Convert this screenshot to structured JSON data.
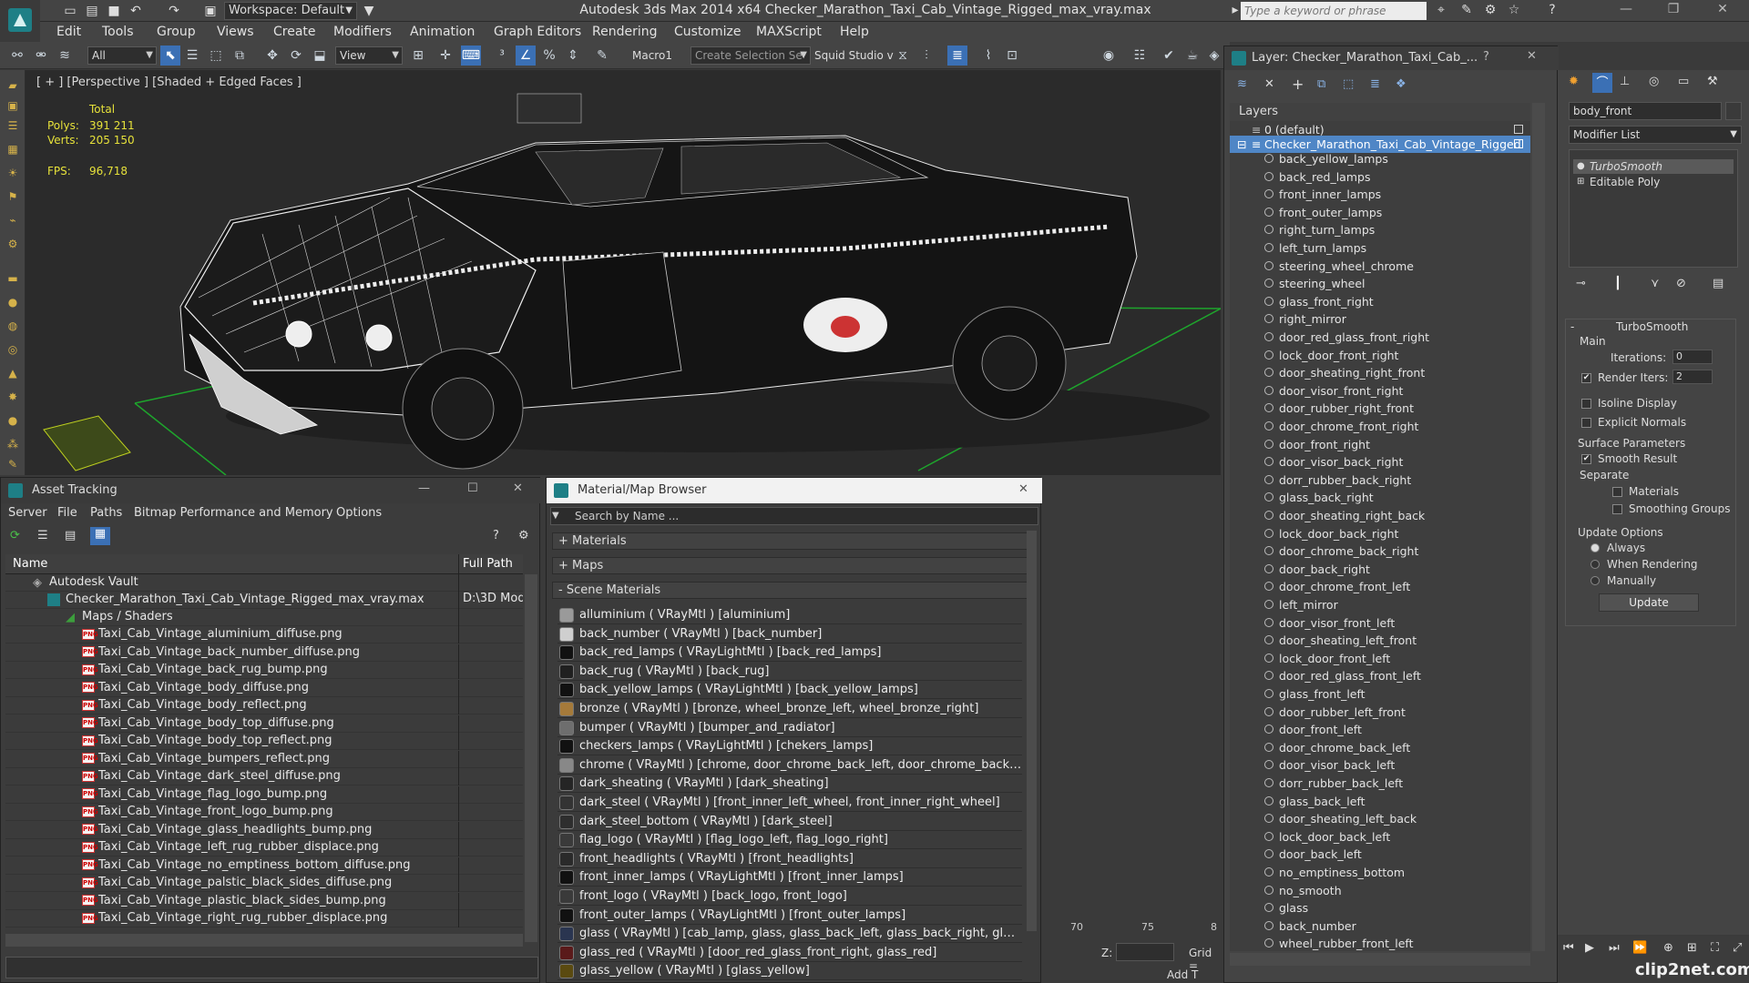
{
  "title_bar": {
    "workspace": "Workspace: Default",
    "title": "Autodesk 3ds Max  2014 x64    Checker_Marathon_Taxi_Cab_Vintage_Rigged_max_vray.max",
    "search_placeholder": "Type a keyword or phrase"
  },
  "menu": [
    "Edit",
    "Tools",
    "Group",
    "Views",
    "Create",
    "Modifiers",
    "Animation",
    "Graph Editors",
    "Rendering",
    "Customize",
    "MAXScript",
    "Help"
  ],
  "toolbar": {
    "selection_filter": "All",
    "ref_coord": "View",
    "macro": "Macro1",
    "selection_set": "Create Selection Se",
    "squid": "Squid Studio v"
  },
  "viewport": {
    "label": "[ + ] [Perspective ] [Shaded + Edged Faces ]",
    "stats": {
      "total_label": "Total",
      "polys_label": "Polys:",
      "polys_value": "391 211",
      "verts_label": "Verts:",
      "verts_value": "205 150",
      "fps_label": "FPS:",
      "fps_value": "96,718"
    }
  },
  "asset_tracking": {
    "title": "Asset Tracking",
    "menu": [
      "Server",
      "File",
      "Paths",
      "Bitmap Performance and Memory",
      "Options"
    ],
    "col_name": "Name",
    "col_path": "Full Path",
    "vault": "Autodesk Vault",
    "scene_file": "Checker_Marathon_Taxi_Cab_Vintage_Rigged_max_vray.max",
    "scene_path": "D:\\3D Mod",
    "maps_folder": "Maps / Shaders",
    "files": [
      "Taxi_Cab_Vintage_aluminium_diffuse.png",
      "Taxi_Cab_Vintage_back_number_diffuse.png",
      "Taxi_Cab_Vintage_back_rug_bump.png",
      "Taxi_Cab_Vintage_body_diffuse.png",
      "Taxi_Cab_Vintage_body_reflect.png",
      "Taxi_Cab_Vintage_body_top_diffuse.png",
      "Taxi_Cab_Vintage_body_top_reflect.png",
      "Taxi_Cab_Vintage_bumpers_reflect.png",
      "Taxi_Cab_Vintage_dark_steel_diffuse.png",
      "Taxi_Cab_Vintage_flag_logo_bump.png",
      "Taxi_Cab_Vintage_front_logo_bump.png",
      "Taxi_Cab_Vintage_glass_headlights_bump.png",
      "Taxi_Cab_Vintage_left_rug_rubber_displace.png",
      "Taxi_Cab_Vintage_no_emptiness_bottom_diffuse.png",
      "Taxi_Cab_Vintage_palstic_black_sides_diffuse.png",
      "Taxi_Cab_Vintage_plastic_black_sides_bump.png",
      "Taxi_Cab_Vintage_right_rug_rubber_displace.png"
    ]
  },
  "material_browser": {
    "title": "Material/Map Browser",
    "search_placeholder": "Search by Name ...",
    "rollout_materials": "+ Materials",
    "rollout_maps": "+ Maps",
    "rollout_scene": "- Scene Materials",
    "materials": [
      {
        "text": "alluminium  ( VRayMtl )  [aluminium]",
        "color": "#9a9a9a"
      },
      {
        "text": "back_number  ( VRayMtl )  [back_number]",
        "color": "#cfcfcf"
      },
      {
        "text": "back_red_lamps  ( VRayLightMtl )  [back_red_lamps]",
        "color": "#111111"
      },
      {
        "text": "back_rug  ( VRayMtl )  [back_rug]",
        "color": "#202020"
      },
      {
        "text": "back_yellow_lamps  ( VRayLightMtl )  [back_yellow_lamps]",
        "color": "#111111"
      },
      {
        "text": "bronze  ( VRayMtl )  [bronze, wheel_bronze_left, wheel_bronze_right]",
        "color": "#a57a3a"
      },
      {
        "text": "bumper  ( VRayMtl )  [bumper_and_radiator]",
        "color": "#6e6e6e"
      },
      {
        "text": "checkers_lamps  ( VRayLightMtl )  [chekers_lamps]",
        "color": "#111111"
      },
      {
        "text": "chrome  ( VRayMtl )  [chrome, door_chrome_back_left, door_chrome_back_right, ...",
        "color": "#888888"
      },
      {
        "text": "dark_sheating  ( VRayMtl )  [dark_sheating]",
        "color": "#252525"
      },
      {
        "text": "dark_steel  ( VRayMtl )  [front_inner_left_wheel, front_inner_right_wheel]",
        "color": "#333333"
      },
      {
        "text": "dark_steel_bottom  ( VRayMtl )  [dark_steel]",
        "color": "#2e2e2e"
      },
      {
        "text": "flag_logo  ( VRayMtl )  [flag_logo_left, flag_logo_right]",
        "color": "#3a3a3a"
      },
      {
        "text": "front_headlights  ( VRayMtl )  [front_headlights]",
        "color": "#2a2a2a"
      },
      {
        "text": "front_inner_lamps  ( VRayLightMtl )  [front_inner_lamps]",
        "color": "#111111"
      },
      {
        "text": "front_logo  ( VRayMtl )  [back_logo, front_logo]",
        "color": "#3a3a3a"
      },
      {
        "text": "front_outer_lamps  ( VRayLightMtl )  [front_outer_lamps]",
        "color": "#111111"
      },
      {
        "text": "glass  ( VRayMtl )  [cab_lamp, glass, glass_back_left, glass_back_right, glass_fro...",
        "color": "#2a3550"
      },
      {
        "text": "glass_red  ( VRayMtl )  [door_red_glass_front_right, glass_red]",
        "color": "#5a1a1a"
      },
      {
        "text": "glass_yellow  ( VRayMtl )  [glass_yellow]",
        "color": "#5a4a10"
      }
    ]
  },
  "timeline": {
    "tick70": "70",
    "tick75": "75",
    "tick80": "8",
    "z_label": "Z:",
    "grid_label": "Grid =",
    "add_t": "Add T"
  },
  "layers": {
    "title": "Layer: Checker_Marathon_Taxi_Cab_...",
    "header": "Layers",
    "default_layer": "0 (default)",
    "main_layer": "Checker_Marathon_Taxi_Cab_Vintage_Rigged",
    "objects": [
      "back_yellow_lamps",
      "back_red_lamps",
      "front_inner_lamps",
      "front_outer_lamps",
      "right_turn_lamps",
      "left_turn_lamps",
      "steering_wheel_chrome",
      "steering_wheel",
      "glass_front_right",
      "right_mirror",
      "door_red_glass_front_right",
      "lock_door_front_right",
      "door_sheating_right_front",
      "door_visor_front_right",
      "door_rubber_right_front",
      "door_chrome_front_right",
      "door_front_right",
      "door_visor_back_right",
      "dorr_rubber_back_right",
      "glass_back_right",
      "door_sheating_right_back",
      "lock_door_back_right",
      "door_chrome_back_right",
      "door_back_right",
      "door_chrome_front_left",
      "left_mirror",
      "door_visor_front_left",
      "door_sheating_left_front",
      "lock_door_front_left",
      "door_red_glass_front_left",
      "glass_front_left",
      "door_rubber_left_front",
      "door_front_left",
      "door_chrome_back_left",
      "door_visor_back_left",
      "dorr_rubber_back_left",
      "glass_back_left",
      "door_sheating_left_back",
      "lock_door_back_left",
      "door_back_left",
      "no_emptiness_bottom",
      "no_smooth",
      "glass",
      "back_number",
      "wheel_rubber_front_left"
    ]
  },
  "command_panel": {
    "object_name": "body_front",
    "modifier_list": "Modifier List",
    "stack": [
      "TurboSmooth",
      "Editable Poly"
    ],
    "turbosmooth_title": "TurboSmooth",
    "main_label": "Main",
    "iterations_label": "Iterations:",
    "iterations_value": "0",
    "render_iters_label": "Render Iters:",
    "render_iters_value": "2",
    "isoline": "Isoline Display",
    "explicit_normals": "Explicit Normals",
    "surface_params": "Surface Parameters",
    "smooth_result": "Smooth Result",
    "separate": "Separate",
    "materials": "Materials",
    "smoothing_groups": "Smoothing Groups",
    "update_options": "Update Options",
    "always": "Always",
    "when_rendering": "When Rendering",
    "manually": "Manually",
    "update_btn": "Update"
  },
  "watermark": "clip2net.com"
}
